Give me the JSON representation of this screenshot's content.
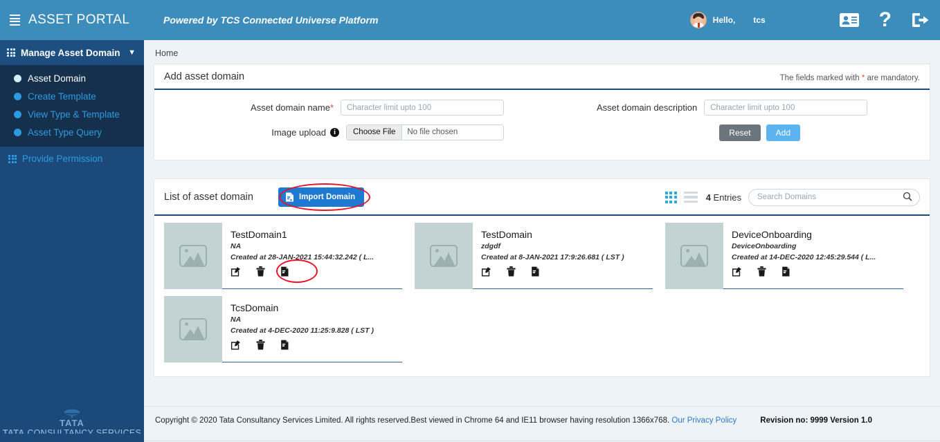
{
  "header": {
    "menu_icon": "hamburger-icon",
    "brand": "ASSET PORTAL",
    "powered_by": "Powered by TCS Connected Universe Platform",
    "greeting": "Hello,",
    "username": "tcs",
    "icons": [
      "id-card-icon",
      "help-icon",
      "logout-icon"
    ],
    "help_glyph": "?"
  },
  "sidebar": {
    "section_title": "Manage Asset Domain",
    "section_chevron": "chevron-down-icon",
    "items": [
      {
        "label": "Asset Domain",
        "active": true
      },
      {
        "label": "Create Template",
        "active": false
      },
      {
        "label": "View Type & Template",
        "active": false
      },
      {
        "label": "Asset Type Query",
        "active": false
      }
    ],
    "secondary_item": "Provide Permission",
    "logo": {
      "tata": "TATA",
      "tcs_prefix": "TATA",
      "tcs_rest": " CONSULTANCY SERVICES"
    }
  },
  "breadcrumb": "Home",
  "form_panel": {
    "title": "Add asset domain",
    "mandatory_note_pre": "The fields marked with ",
    "mandatory_star": "*",
    "mandatory_note_post": " are mandatory.",
    "fields": {
      "name_label": "Asset domain name",
      "name_required_mark": "*",
      "name_placeholder": "Character limit upto 100",
      "name_value": "",
      "description_label": "Asset domain description",
      "description_placeholder": "Character limit upto 100",
      "description_value": "",
      "image_label": "Image upload",
      "image_info_icon": "info-icon",
      "file_button": "Choose File",
      "file_status": "No file chosen"
    },
    "reset_label": "Reset",
    "add_label": "Add"
  },
  "list_panel": {
    "title": "List of asset domain",
    "import_label": "Import Domain",
    "import_icon": "import-file-icon",
    "grid_view_icon": "grid-view-icon",
    "list_view_icon": "list-view-icon",
    "entries_count": "4",
    "entries_label": " Entries",
    "search_placeholder": "Search Domains",
    "search_value": "",
    "search_icon": "search-icon",
    "action_icons": [
      "edit-icon",
      "delete-icon",
      "export-icon"
    ],
    "cards": [
      {
        "name": "TestDomain1",
        "description": "NA",
        "created": "Created at 28-JAN-2021 15:44:32.242 ( L...",
        "thumb_icon": "image-placeholder-icon",
        "highlighted_action": true
      },
      {
        "name": "TestDomain",
        "description": "zdgdf",
        "created": "Created at 8-JAN-2021 17:9:26.681 ( LST )",
        "thumb_icon": "image-placeholder-icon",
        "highlighted_action": false
      },
      {
        "name": "DeviceOnboarding",
        "description": "DeviceOnboarding",
        "created": "Created at 14-DEC-2020 12:45:29.544 ( L...",
        "thumb_icon": "image-placeholder-icon",
        "highlighted_action": false
      },
      {
        "name": "TcsDomain",
        "description": "NA",
        "created": "Created at 4-DEC-2020 11:25:9.828 ( LST )",
        "thumb_icon": "image-placeholder-icon",
        "highlighted_action": false
      }
    ]
  },
  "footer": {
    "copyright": "Copyright © 2020 Tata Consultancy Services Limited. All rights reserved.Best viewed in Chrome 64 and IE11 browser having resolution 1366x768. ",
    "privacy_link": "Our Privacy Policy",
    "revision": "Revision no: 9999 Version 1.0"
  },
  "colors": {
    "header_blue": "#3c8dbc",
    "sidebar_navy": "#1b4a7a",
    "submenu_navy": "#14304d",
    "accent_blue": "#2c9ae0",
    "import_blue": "#1e7ad0",
    "annotation_red": "#e8132b",
    "add_button": "#5bb3f0",
    "reset_button": "#6c757d"
  }
}
